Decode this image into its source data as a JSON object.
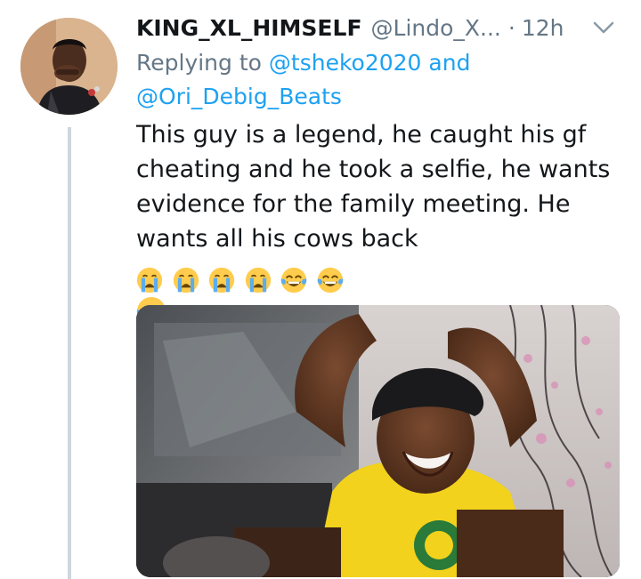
{
  "tweet": {
    "display_name": "KING_XL_HIMSELF",
    "handle": "@Lindo_X...",
    "separator": "·",
    "time": "12h",
    "replying_prefix": "Replying to",
    "reply_mentions": [
      "@tsheko2020",
      "@Ori_Debig_Beats"
    ],
    "reply_joiner": "and",
    "body_text": "This guy is a legend, he caught his gf cheating and he took a selfie, he wants evidence for the family meeting. He wants all his cows back",
    "emojis": [
      "crying-face-icon",
      "crying-face-icon",
      "crying-face-icon",
      "crying-face-icon",
      "tears-of-joy-icon",
      "tears-of-joy-icon",
      "tears-of-joy-icon"
    ]
  },
  "colors": {
    "text": "#14171a",
    "secondary": "#657786",
    "link": "#1da1f2",
    "thread_line": "#ccd6dd"
  }
}
